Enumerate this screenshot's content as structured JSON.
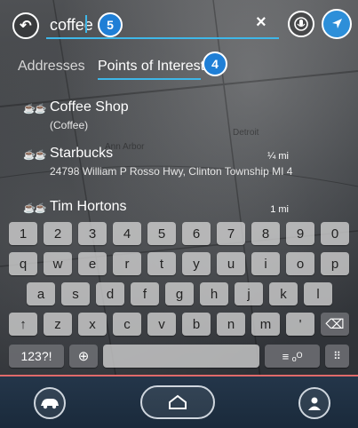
{
  "search": {
    "query": "coffee",
    "clear_symbol": "×",
    "callout_number": "5"
  },
  "tabs": [
    {
      "label": "Addresses",
      "active": false
    },
    {
      "label": "Points of Interest",
      "active": true,
      "callout_number": "4"
    }
  ],
  "results": [
    {
      "icon": "coffee-cup-icon",
      "name": "Coffee Shop",
      "subtitle": "(Coffee)",
      "distance": ""
    },
    {
      "icon": "coffee-cup-icon",
      "name": "Starbucks",
      "subtitle": "24798 William P Rosso Hwy, Clinton Township MI 4",
      "distance": "¼ mi"
    },
    {
      "icon": "coffee-cup-icon",
      "name": "Tim Hortons",
      "subtitle": "",
      "distance": "1 mi"
    }
  ],
  "map_labels": [
    "Ann Arbor",
    "Detroit"
  ],
  "keyboard": {
    "row1": [
      "1",
      "2",
      "3",
      "4",
      "5",
      "6",
      "7",
      "8",
      "9",
      "0"
    ],
    "row2": [
      "q",
      "w",
      "e",
      "r",
      "t",
      "y",
      "u",
      "i",
      "o",
      "p"
    ],
    "row3": [
      "a",
      "s",
      "d",
      "f",
      "g",
      "h",
      "j",
      "k",
      "l"
    ],
    "row4": [
      "z",
      "x",
      "c",
      "v",
      "b",
      "n",
      "m",
      "'"
    ],
    "numbers_label": "123?!",
    "shift_symbol": "↑",
    "backspace_symbol": "⌫",
    "globe_symbol": "⊕",
    "settings_symbol": "≡ ₒᴼ",
    "hide_symbol": "⠿"
  },
  "colors": {
    "accent": "#3fb7e8",
    "badge": "#1f7fd6",
    "nav_button": "#2d8fd9",
    "divider": "#e06a6a"
  }
}
